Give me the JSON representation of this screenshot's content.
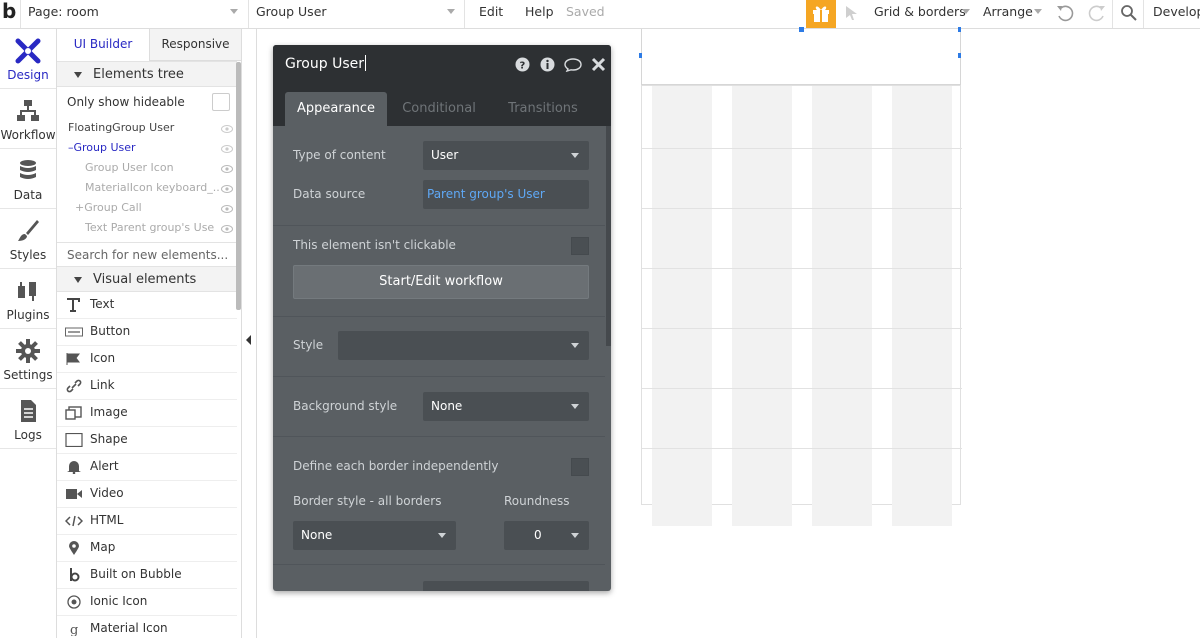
{
  "topbar": {
    "logo": "b",
    "page_select": "Page: room",
    "element_select": "Group User",
    "edit": "Edit",
    "help": "Help",
    "saved": "Saved",
    "grid_borders": "Grid & borders",
    "arrange": "Arrange",
    "develop": "Develop"
  },
  "rail": [
    {
      "label": "Design"
    },
    {
      "label": "Workflow"
    },
    {
      "label": "Data"
    },
    {
      "label": "Styles"
    },
    {
      "label": "Plugins"
    },
    {
      "label": "Settings"
    },
    {
      "label": "Logs"
    }
  ],
  "panel": {
    "tab_builder": "UI Builder",
    "tab_responsive": "Responsive",
    "elements_tree": "Elements tree",
    "only_hideable": "Only show hideable",
    "tree": [
      "FloatingGroup User",
      "Group User",
      "Group User Icon",
      "MaterialIcon keyboard_...",
      "Group Call",
      "Text Parent group's User'"
    ],
    "search_placeholder": "Search for new elements...",
    "visual_elements": "Visual elements",
    "visual": [
      "Text",
      "Button",
      "Icon",
      "Link",
      "Image",
      "Shape",
      "Alert",
      "Video",
      "HTML",
      "Map",
      "Built on Bubble",
      "Ionic Icon",
      "Material Icon"
    ]
  },
  "editor": {
    "title": "Group User",
    "tabs": [
      "Appearance",
      "Conditional",
      "Transitions"
    ],
    "type_of_content_label": "Type of content",
    "type_of_content_value": "User",
    "data_source_label": "Data source",
    "data_source_value": "Parent group's User",
    "not_clickable_label": "This element isn't clickable",
    "workflow_button": "Start/Edit workflow",
    "style_label": "Style",
    "style_value": "",
    "bg_style_label": "Background style",
    "bg_style_value": "None",
    "border_indep_label": "Define each border independently",
    "border_style_label": "Border style - all borders",
    "border_style_value": "None",
    "roundness_label": "Roundness",
    "roundness_value": "0"
  },
  "colors": {
    "accent": "#2929c3",
    "editor_bg": "#5a5f63",
    "editor_head": "#2d3033",
    "link": "#5fa8f5",
    "gift": "#f5a623"
  }
}
